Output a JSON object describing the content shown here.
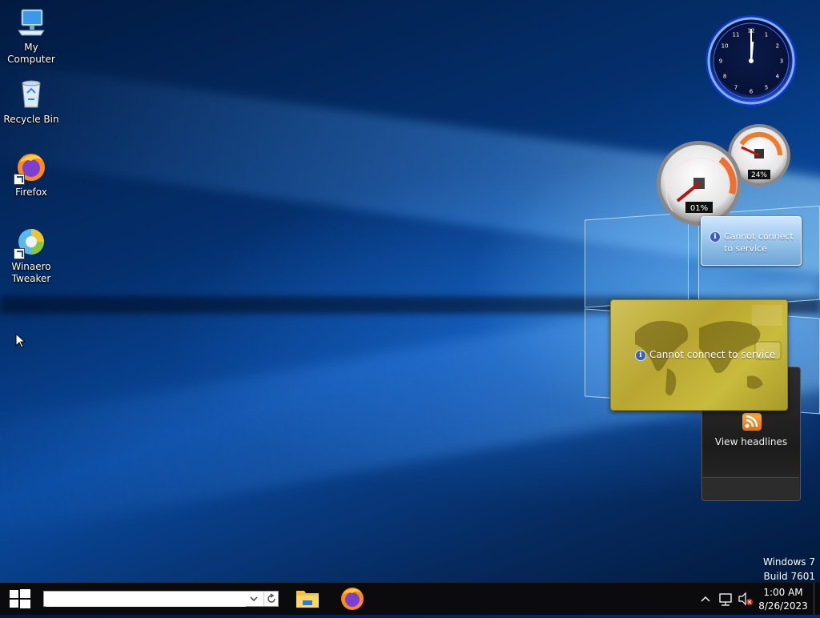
{
  "desktop": {
    "icons": [
      {
        "label": "My Computer"
      },
      {
        "label": "Recycle Bin"
      },
      {
        "label": "Firefox"
      },
      {
        "label": "Winaero Tweaker"
      }
    ]
  },
  "gadgets": {
    "clock": {
      "numerals": [
        "12",
        "1",
        "2",
        "3",
        "4",
        "5",
        "6",
        "7",
        "8",
        "9",
        "10",
        "11"
      ]
    },
    "meters": {
      "cpu_label": "01%",
      "memory_label": "24%"
    },
    "meter_tooltip": {
      "text_line1": "Cannot connect",
      "text_line2": "to service"
    },
    "currency": {
      "message": "Cannot connect to service"
    },
    "feed": {
      "label": "View headlines"
    }
  },
  "watermark": {
    "line1": "Windows 7",
    "line2": "Build 7601"
  },
  "taskbar": {
    "search_placeholder": "",
    "clock_time": "1:00 AM",
    "clock_date": "8/26/2023"
  },
  "colors": {
    "taskbar": "#0b0b0d",
    "accent": "#0a4aa0"
  }
}
